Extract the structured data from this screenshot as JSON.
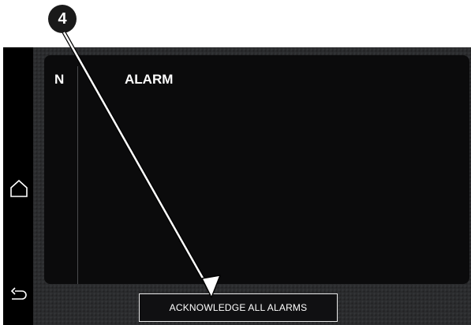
{
  "callout": {
    "number": "4"
  },
  "sidebar": {
    "items": [
      {
        "icon": "home-icon"
      },
      {
        "icon": "back-arrow-icon"
      }
    ]
  },
  "alarm_table": {
    "column_n": "N",
    "column_alarm": "ALARM",
    "rows": []
  },
  "actions": {
    "acknowledge_all_label": "ACKNOWLEDGE ALL ALARMS"
  },
  "colors": {
    "screen_background": "#2b2c2e",
    "panel_background": "#0b0b0c",
    "text": "#ffffff"
  }
}
